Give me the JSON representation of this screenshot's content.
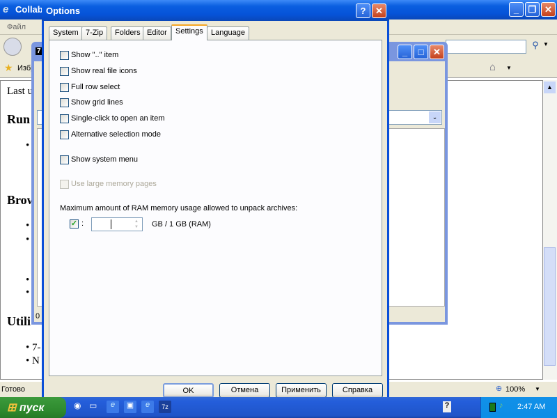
{
  "browser": {
    "title": "Collab",
    "menu_file": "Файл",
    "favorites": "Избранное",
    "content": {
      "line1": "Last u",
      "h_run": "Run",
      "h_browse": "Brow",
      "h_util": "Utili",
      "item_7z": "7-",
      "item_n": "N"
    },
    "status": "Готово",
    "zoom": "100%"
  },
  "zip_window": {
    "title_icon": "7",
    "status": "0"
  },
  "dialog": {
    "title": "Options",
    "tabs": [
      "System",
      "7-Zip",
      "Folders",
      "Editor",
      "Settings",
      "Language"
    ],
    "active_tab": "Settings",
    "options": [
      {
        "label": "Show \"..\" item",
        "checked": false
      },
      {
        "label": "Show real file icons",
        "checked": false
      },
      {
        "label": "Full row select",
        "checked": false
      },
      {
        "label": "Show grid lines",
        "checked": false
      },
      {
        "label": "Single-click to open an item",
        "checked": false
      },
      {
        "label": "Alternative selection mode",
        "checked": false
      },
      {
        "label": "Show system menu",
        "checked": false
      },
      {
        "label": "Use large memory pages",
        "checked": false,
        "disabled": true
      }
    ],
    "ram_label": "Maximum amount of RAM memory usage allowed to unpack archives:",
    "ram_checked": true,
    "ram_colon": ":",
    "ram_value": "",
    "ram_suffix": "GB / 1 GB (RAM)",
    "buttons": {
      "ok": "OK",
      "cancel": "Отмена",
      "apply": "Применить",
      "help": "Справка"
    }
  },
  "taskbar": {
    "start": "пуск",
    "clock": "2:47 AM"
  }
}
